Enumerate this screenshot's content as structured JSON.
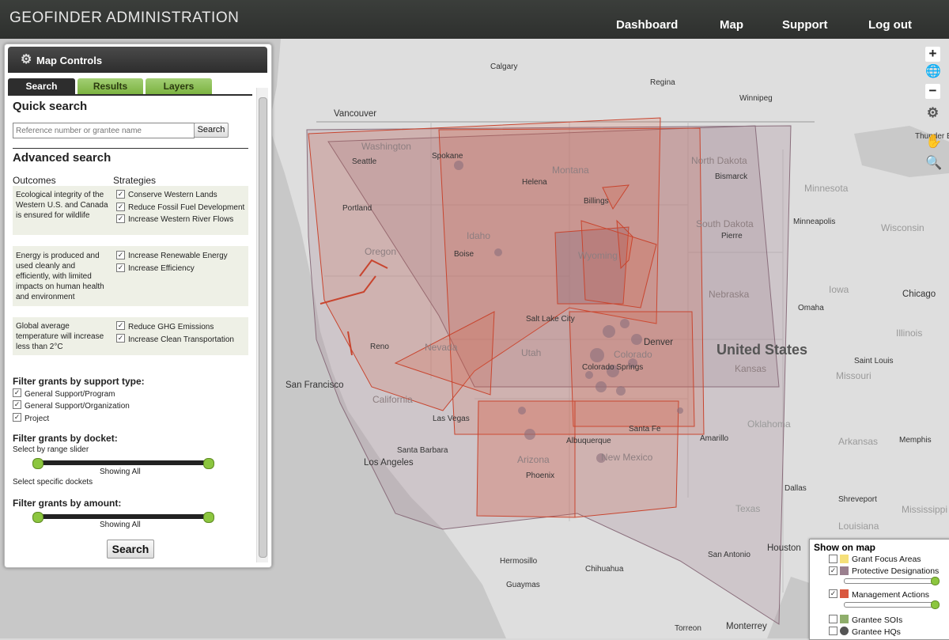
{
  "header": {
    "brand": "GEOFINDER ADMINISTRATION",
    "nav": [
      "Dashboard",
      "Map",
      "Support",
      "Log out"
    ]
  },
  "panel": {
    "title": "Map Controls",
    "tabs": [
      "Search",
      "Results",
      "Layers"
    ],
    "quick_search": {
      "heading": "Quick search",
      "placeholder": "Reference number or grantee name",
      "button": "Search"
    },
    "advanced": {
      "heading": "Advanced search",
      "outcomes_label": "Outcomes",
      "strategies_label": "Strategies",
      "groups": [
        {
          "outcome": "Ecological integrity of the Western U.S. and Canada is ensured for wildlife",
          "strategies": [
            "Conserve Western Lands",
            "Reduce Fossil Fuel Development",
            "Increase Western River Flows"
          ]
        },
        {
          "outcome": "Energy is produced and used cleanly and efficiently, with limited impacts on human health and environment",
          "strategies": [
            "Increase Renewable Energy",
            "Increase Efficiency"
          ]
        },
        {
          "outcome": "Global average temperature will increase less than 2°C",
          "strategies": [
            "Reduce GHG Emissions",
            "Increase Clean Transportation"
          ]
        }
      ]
    },
    "support_type": {
      "heading": "Filter grants by support type:",
      "options": [
        "General Support/Program",
        "General Support/Organization",
        "Project"
      ]
    },
    "docket": {
      "heading": "Filter grants by docket:",
      "sub": "Select by range slider",
      "showing": "Showing All",
      "specific": "Select specific dockets"
    },
    "amount": {
      "heading": "Filter grants by amount:",
      "showing": "Showing All"
    },
    "search_button": "Search"
  },
  "map_controls": {
    "zoom_in": "+",
    "zoom_out": "−"
  },
  "map": {
    "country_label": "United States",
    "states": [
      "Washington",
      "Oregon",
      "Idaho",
      "Montana",
      "Wyoming",
      "Nevada",
      "Utah",
      "California",
      "Colorado",
      "Arizona",
      "New Mexico",
      "North Dakota",
      "South Dakota",
      "Nebraska",
      "Kansas",
      "Oklahoma",
      "Texas",
      "Minnesota",
      "Wisconsin",
      "Iowa",
      "Illinois",
      "Missouri",
      "Arkansas",
      "Louisiana",
      "Mississippi"
    ],
    "cities": [
      "Calgary",
      "Regina",
      "Winnipeg",
      "Vancouver",
      "Spokane",
      "Seattle",
      "Helena",
      "Bismarck",
      "Billings",
      "Portland",
      "Boise",
      "Pierre",
      "Minneapolis",
      "Salt Lake City",
      "Omaha",
      "Denver",
      "Reno",
      "Colorado Springs",
      "Chicago",
      "Saint Louis",
      "San Francisco",
      "Las Vegas",
      "Santa Fe",
      "Amarillo",
      "Memphis",
      "Santa Barbara",
      "Albuquerque",
      "Los Angeles",
      "Phoenix",
      "Dallas",
      "Shreveport",
      "Houston",
      "San Antonio",
      "Hermosillo",
      "Chihuahua",
      "Guaymas",
      "Torreon",
      "Monterrey",
      "Thunder B"
    ]
  },
  "legend": {
    "title": "Show on map",
    "items": [
      {
        "label": "Grant Focus Areas",
        "color": "#f5e07a",
        "checked": false,
        "slider": false
      },
      {
        "label": "Protective Designations",
        "color": "#9a7f8e",
        "checked": true,
        "slider": true
      },
      {
        "label": "Management Actions",
        "color": "#d9583f",
        "checked": true,
        "slider": true
      },
      {
        "label": "Grantee SOIs",
        "color": "#8fae6b",
        "checked": false,
        "slider": false
      },
      {
        "label": "Grantee HQs",
        "color": "#555555",
        "checked": false,
        "slider": false
      }
    ]
  }
}
